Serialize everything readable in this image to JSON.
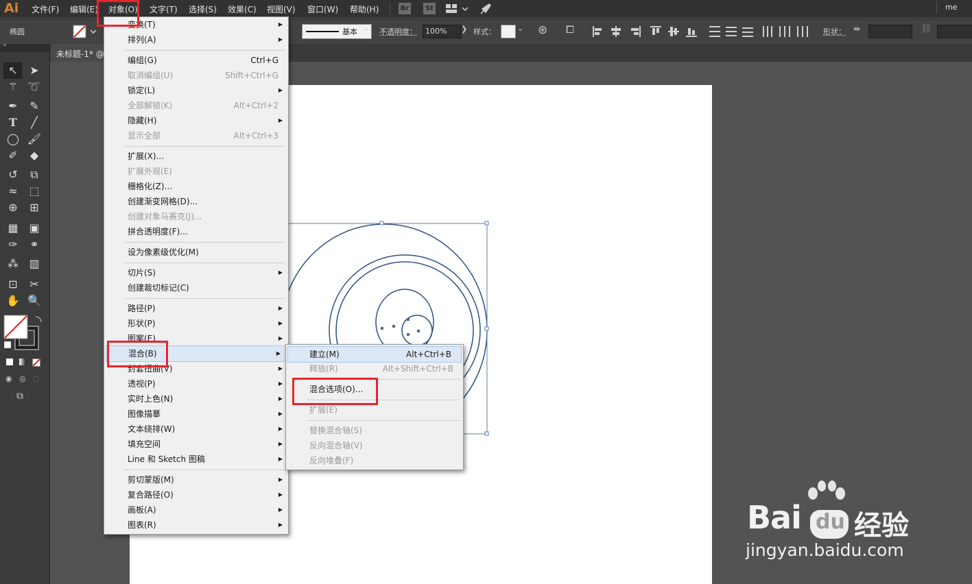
{
  "app": {
    "logo": "Ai"
  },
  "menubar": {
    "items": [
      "文件(F)",
      "编辑(E)",
      "对象(O)",
      "文字(T)",
      "选择(S)",
      "效果(C)",
      "视图(V)",
      "窗口(W)",
      "帮助(H)"
    ],
    "icons": [
      "Br",
      "St"
    ],
    "right_text": "me"
  },
  "controlbar": {
    "shape_label": "椭圆",
    "stroke_style": "基本",
    "opacity_label": "不透明度：",
    "opacity_value": "100%",
    "style_label": "样式：",
    "shape_prop_label": "形状："
  },
  "document": {
    "tab_title": "未标题-1* @"
  },
  "object_menu": {
    "items": [
      {
        "label": "变换(T)",
        "submenu": true
      },
      {
        "label": "排列(A)",
        "submenu": true
      },
      {
        "label": "编组(G)",
        "shortcut": "Ctrl+G"
      },
      {
        "label": "取消编组(U)",
        "shortcut": "Shift+Ctrl+G",
        "disabled": true
      },
      {
        "label": "锁定(L)",
        "submenu": true
      },
      {
        "label": "全部解锁(K)",
        "shortcut": "Alt+Ctrl+2",
        "disabled": true
      },
      {
        "label": "隐藏(H)",
        "submenu": true
      },
      {
        "label": "显示全部",
        "shortcut": "Alt+Ctrl+3",
        "disabled": true
      },
      {
        "label": "扩展(X)..."
      },
      {
        "label": "扩展外观(E)",
        "disabled": true
      },
      {
        "label": "栅格化(Z)..."
      },
      {
        "label": "创建渐变网格(D)..."
      },
      {
        "label": "创建对象马赛克(J)...",
        "disabled": true
      },
      {
        "label": "拼合透明度(F)..."
      },
      {
        "label": "设为像素级优化(M)"
      },
      {
        "label": "切片(S)",
        "submenu": true
      },
      {
        "label": "创建裁切标记(C)"
      },
      {
        "label": "路径(P)",
        "submenu": true
      },
      {
        "label": "形状(P)",
        "submenu": true
      },
      {
        "label": "图案(E)",
        "submenu": true
      },
      {
        "label": "混合(B)",
        "submenu": true,
        "highlighted": true
      },
      {
        "label": "封套扭曲(V)",
        "submenu": true
      },
      {
        "label": "透视(P)",
        "submenu": true
      },
      {
        "label": "实时上色(N)",
        "submenu": true
      },
      {
        "label": "图像描摹",
        "submenu": true
      },
      {
        "label": "文本绕排(W)",
        "submenu": true
      },
      {
        "label": "填充空间",
        "submenu": true
      },
      {
        "label": "Line 和 Sketch 图稿",
        "submenu": true
      },
      {
        "label": "剪切蒙版(M)",
        "submenu": true
      },
      {
        "label": "复合路径(O)",
        "submenu": true
      },
      {
        "label": "画板(A)",
        "submenu": true
      },
      {
        "label": "图表(R)",
        "submenu": true
      }
    ]
  },
  "blend_submenu": {
    "items": [
      {
        "label": "建立(M)",
        "shortcut": "Alt+Ctrl+B",
        "highlighted": true
      },
      {
        "label": "释放(R)",
        "shortcut": "Alt+Shift+Ctrl+B",
        "disabled": true
      },
      {
        "label": "混合选项(O)..."
      },
      {
        "label": "扩展(E)",
        "disabled": true
      },
      {
        "label": "替换混合轴(S)",
        "disabled": true
      },
      {
        "label": "反向混合轴(V)",
        "disabled": true
      },
      {
        "label": "反向堆叠(F)",
        "disabled": true
      }
    ]
  },
  "watermark": {
    "brand": "Bai",
    "brand2": "du",
    "cn": "经验",
    "url": "jingyan.baidu.com"
  },
  "colors": {
    "highlight_box": "#e8242d",
    "path_stroke": "#2f4f80"
  }
}
